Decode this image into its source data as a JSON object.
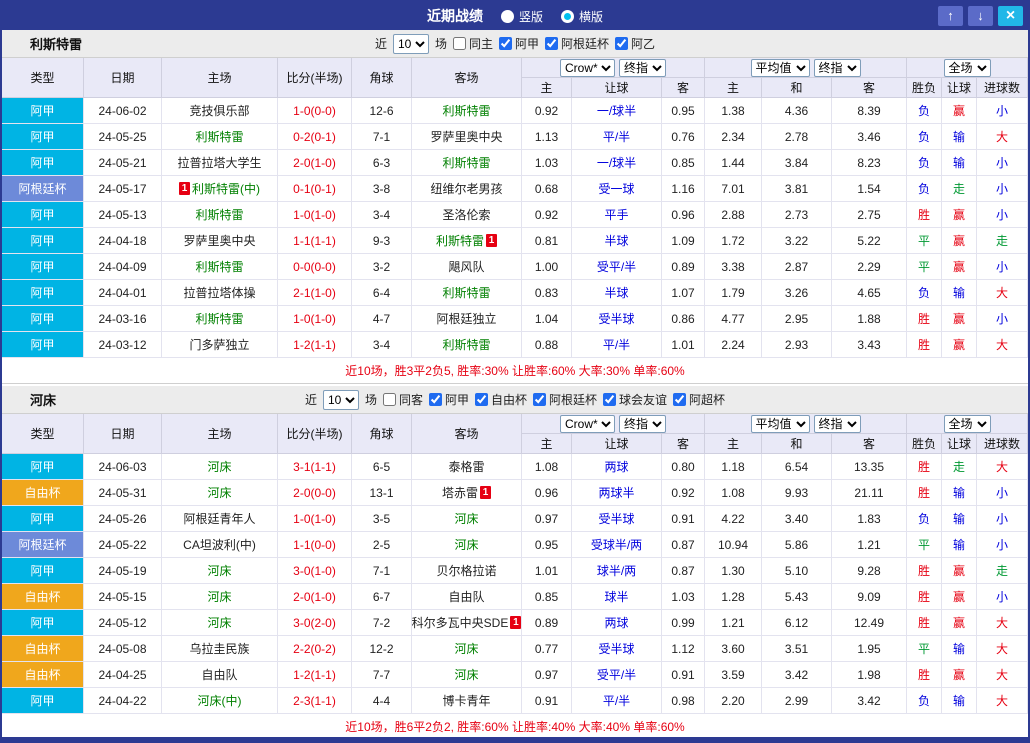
{
  "titlebar": {
    "title": "近期战绩",
    "radio_vertical": "竖版",
    "radio_horizontal": "横版",
    "up_glyph": "↑",
    "down_glyph": "↓",
    "close_glyph": "×"
  },
  "colors": {
    "league": {
      "阿甲": "#00b4e4",
      "阿根廷杯": "#6d8ad9",
      "自由杯": "#f0a71c",
      "阿乙": "#00b4e4"
    },
    "result": {
      "red": "#e60012",
      "blue": "#0000dd",
      "green": "#009933"
    },
    "score": "#e60012",
    "focus_team": "#008000",
    "handicap": "#0000dd",
    "red_card_badge": "#e60012"
  },
  "sections": [
    {
      "team": "利斯特雷",
      "filters": {
        "near_label": "近",
        "count": "10",
        "games_label": "场",
        "same": {
          "label": "同主",
          "checked": false
        },
        "leagues": [
          {
            "label": "阿甲",
            "checked": true
          },
          {
            "label": "阿根廷杯",
            "checked": true
          },
          {
            "label": "阿乙",
            "checked": true
          }
        ]
      },
      "table_header": {
        "static": [
          "类型",
          "日期",
          "主场",
          "比分(半场)",
          "角球",
          "客场"
        ],
        "odds_group": {
          "company": "Crow*",
          "time": "终指",
          "sub": [
            "主",
            "让球",
            "客"
          ]
        },
        "avg_group": {
          "company": "平均值",
          "time": "终指",
          "sub": [
            "主",
            "和",
            "客"
          ]
        },
        "result_group": {
          "scope": "全场",
          "sub": [
            "胜负",
            "让球",
            "进球数"
          ]
        }
      },
      "rows": [
        {
          "league": "阿甲",
          "date": "24-06-02",
          "home": {
            "name": "竞技俱乐部",
            "focus": false
          },
          "score": "1-0(0-0)",
          "corner": "12-6",
          "away": {
            "name": "利斯特雷",
            "focus": true
          },
          "odds": [
            "0.92",
            "一/球半",
            "0.95"
          ],
          "avg": [
            "1.38",
            "4.36",
            "8.39"
          ],
          "results": [
            {
              "text": "负",
              "color": "blue"
            },
            {
              "text": "赢",
              "color": "red"
            },
            {
              "text": "小",
              "color": "blue"
            }
          ]
        },
        {
          "league": "阿甲",
          "date": "24-05-25",
          "home": {
            "name": "利斯特雷",
            "focus": true
          },
          "score": "0-2(0-1)",
          "corner": "7-1",
          "away": {
            "name": "罗萨里奥中央",
            "focus": false
          },
          "odds": [
            "1.13",
            "平/半",
            "0.76"
          ],
          "avg": [
            "2.34",
            "2.78",
            "3.46"
          ],
          "results": [
            {
              "text": "负",
              "color": "blue"
            },
            {
              "text": "输",
              "color": "blue"
            },
            {
              "text": "大",
              "color": "red"
            }
          ]
        },
        {
          "league": "阿甲",
          "date": "24-05-21",
          "home": {
            "name": "拉普拉塔大学生",
            "focus": false
          },
          "score": "2-0(1-0)",
          "corner": "6-3",
          "away": {
            "name": "利斯特雷",
            "focus": true
          },
          "odds": [
            "1.03",
            "一/球半",
            "0.85"
          ],
          "avg": [
            "1.44",
            "3.84",
            "8.23"
          ],
          "results": [
            {
              "text": "负",
              "color": "blue"
            },
            {
              "text": "输",
              "color": "blue"
            },
            {
              "text": "小",
              "color": "blue"
            }
          ]
        },
        {
          "league": "阿根廷杯",
          "date": "24-05-17",
          "home": {
            "name": "利斯特雷(中)",
            "focus": true,
            "red_card": {
              "position": "before",
              "count": "1"
            }
          },
          "score": "0-1(0-1)",
          "corner": "3-8",
          "away": {
            "name": "纽维尔老男孩",
            "focus": false
          },
          "odds": [
            "0.68",
            "受一球",
            "1.16"
          ],
          "avg": [
            "7.01",
            "3.81",
            "1.54"
          ],
          "results": [
            {
              "text": "负",
              "color": "blue"
            },
            {
              "text": "走",
              "color": "green"
            },
            {
              "text": "小",
              "color": "blue"
            }
          ]
        },
        {
          "league": "阿甲",
          "date": "24-05-13",
          "home": {
            "name": "利斯特雷",
            "focus": true
          },
          "score": "1-0(1-0)",
          "corner": "3-4",
          "away": {
            "name": "圣洛伦索",
            "focus": false
          },
          "odds": [
            "0.92",
            "平手",
            "0.96"
          ],
          "avg": [
            "2.88",
            "2.73",
            "2.75"
          ],
          "results": [
            {
              "text": "胜",
              "color": "red"
            },
            {
              "text": "赢",
              "color": "red"
            },
            {
              "text": "小",
              "color": "blue"
            }
          ]
        },
        {
          "league": "阿甲",
          "date": "24-04-18",
          "home": {
            "name": "罗萨里奥中央",
            "focus": false
          },
          "score": "1-1(1-1)",
          "corner": "9-3",
          "away": {
            "name": "利斯特雷",
            "focus": true,
            "red_card": {
              "position": "after",
              "count": "1"
            }
          },
          "odds": [
            "0.81",
            "半球",
            "1.09"
          ],
          "avg": [
            "1.72",
            "3.22",
            "5.22"
          ],
          "results": [
            {
              "text": "平",
              "color": "green"
            },
            {
              "text": "赢",
              "color": "red"
            },
            {
              "text": "走",
              "color": "green"
            }
          ]
        },
        {
          "league": "阿甲",
          "date": "24-04-09",
          "home": {
            "name": "利斯特雷",
            "focus": true
          },
          "score": "0-0(0-0)",
          "corner": "3-2",
          "away": {
            "name": "飓风队",
            "focus": false
          },
          "odds": [
            "1.00",
            "受平/半",
            "0.89"
          ],
          "avg": [
            "3.38",
            "2.87",
            "2.29"
          ],
          "results": [
            {
              "text": "平",
              "color": "green"
            },
            {
              "text": "赢",
              "color": "red"
            },
            {
              "text": "小",
              "color": "blue"
            }
          ]
        },
        {
          "league": "阿甲",
          "date": "24-04-01",
          "home": {
            "name": "拉普拉塔体操",
            "focus": false
          },
          "score": "2-1(1-0)",
          "corner": "6-4",
          "away": {
            "name": "利斯特雷",
            "focus": true
          },
          "odds": [
            "0.83",
            "半球",
            "1.07"
          ],
          "avg": [
            "1.79",
            "3.26",
            "4.65"
          ],
          "results": [
            {
              "text": "负",
              "color": "blue"
            },
            {
              "text": "输",
              "color": "blue"
            },
            {
              "text": "大",
              "color": "red"
            }
          ]
        },
        {
          "league": "阿甲",
          "date": "24-03-16",
          "home": {
            "name": "利斯特雷",
            "focus": true
          },
          "score": "1-0(1-0)",
          "corner": "4-7",
          "away": {
            "name": "阿根廷独立",
            "focus": false
          },
          "odds": [
            "1.04",
            "受半球",
            "0.86"
          ],
          "avg": [
            "4.77",
            "2.95",
            "1.88"
          ],
          "results": [
            {
              "text": "胜",
              "color": "red"
            },
            {
              "text": "赢",
              "color": "red"
            },
            {
              "text": "小",
              "color": "blue"
            }
          ]
        },
        {
          "league": "阿甲",
          "date": "24-03-12",
          "home": {
            "name": "门多萨独立",
            "focus": false
          },
          "score": "1-2(1-1)",
          "corner": "3-4",
          "away": {
            "name": "利斯特雷",
            "focus": true
          },
          "odds": [
            "0.88",
            "平/半",
            "1.01"
          ],
          "avg": [
            "2.24",
            "2.93",
            "3.43"
          ],
          "results": [
            {
              "text": "胜",
              "color": "red"
            },
            {
              "text": "赢",
              "color": "red"
            },
            {
              "text": "大",
              "color": "red"
            }
          ]
        }
      ],
      "summary": "近10场，胜3平2负5, 胜率:30% 让胜率:60% 大率:30% 单率:60%"
    },
    {
      "team": "河床",
      "filters": {
        "near_label": "近",
        "count": "10",
        "games_label": "场",
        "same": {
          "label": "同客",
          "checked": false
        },
        "leagues": [
          {
            "label": "阿甲",
            "checked": true
          },
          {
            "label": "自由杯",
            "checked": true
          },
          {
            "label": "阿根廷杯",
            "checked": true
          },
          {
            "label": "球会友谊",
            "checked": true
          },
          {
            "label": "阿超杯",
            "checked": true
          }
        ]
      },
      "table_header": {
        "static": [
          "类型",
          "日期",
          "主场",
          "比分(半场)",
          "角球",
          "客场"
        ],
        "odds_group": {
          "company": "Crow*",
          "time": "终指",
          "sub": [
            "主",
            "让球",
            "客"
          ]
        },
        "avg_group": {
          "company": "平均值",
          "time": "终指",
          "sub": [
            "主",
            "和",
            "客"
          ]
        },
        "result_group": {
          "scope": "全场",
          "sub": [
            "胜负",
            "让球",
            "进球数"
          ]
        }
      },
      "rows": [
        {
          "league": "阿甲",
          "date": "24-06-03",
          "home": {
            "name": "河床",
            "focus": true
          },
          "score": "3-1(1-1)",
          "corner": "6-5",
          "away": {
            "name": "泰格雷",
            "focus": false
          },
          "odds": [
            "1.08",
            "两球",
            "0.80"
          ],
          "avg": [
            "1.18",
            "6.54",
            "13.35"
          ],
          "results": [
            {
              "text": "胜",
              "color": "red"
            },
            {
              "text": "走",
              "color": "green"
            },
            {
              "text": "大",
              "color": "red"
            }
          ]
        },
        {
          "league": "自由杯",
          "date": "24-05-31",
          "home": {
            "name": "河床",
            "focus": true
          },
          "score": "2-0(0-0)",
          "corner": "13-1",
          "away": {
            "name": "塔赤雷",
            "focus": false,
            "red_card": {
              "position": "after",
              "count": "1"
            }
          },
          "odds": [
            "0.96",
            "两球半",
            "0.92"
          ],
          "avg": [
            "1.08",
            "9.93",
            "21.11"
          ],
          "results": [
            {
              "text": "胜",
              "color": "red"
            },
            {
              "text": "输",
              "color": "blue"
            },
            {
              "text": "小",
              "color": "blue"
            }
          ]
        },
        {
          "league": "阿甲",
          "date": "24-05-26",
          "home": {
            "name": "阿根廷青年人",
            "focus": false
          },
          "score": "1-0(1-0)",
          "corner": "3-5",
          "away": {
            "name": "河床",
            "focus": true
          },
          "odds": [
            "0.97",
            "受半球",
            "0.91"
          ],
          "avg": [
            "4.22",
            "3.40",
            "1.83"
          ],
          "results": [
            {
              "text": "负",
              "color": "blue"
            },
            {
              "text": "输",
              "color": "blue"
            },
            {
              "text": "小",
              "color": "blue"
            }
          ]
        },
        {
          "league": "阿根廷杯",
          "date": "24-05-22",
          "home": {
            "name": "CA坦波利(中)",
            "focus": false
          },
          "score": "1-1(0-0)",
          "corner": "2-5",
          "away": {
            "name": "河床",
            "focus": true
          },
          "odds": [
            "0.95",
            "受球半/两",
            "0.87"
          ],
          "avg": [
            "10.94",
            "5.86",
            "1.21"
          ],
          "results": [
            {
              "text": "平",
              "color": "green"
            },
            {
              "text": "输",
              "color": "blue"
            },
            {
              "text": "小",
              "color": "blue"
            }
          ]
        },
        {
          "league": "阿甲",
          "date": "24-05-19",
          "home": {
            "name": "河床",
            "focus": true
          },
          "score": "3-0(1-0)",
          "corner": "7-1",
          "away": {
            "name": "贝尔格拉诺",
            "focus": false
          },
          "odds": [
            "1.01",
            "球半/两",
            "0.87"
          ],
          "avg": [
            "1.30",
            "5.10",
            "9.28"
          ],
          "results": [
            {
              "text": "胜",
              "color": "red"
            },
            {
              "text": "赢",
              "color": "red"
            },
            {
              "text": "走",
              "color": "green"
            }
          ]
        },
        {
          "league": "自由杯",
          "date": "24-05-15",
          "home": {
            "name": "河床",
            "focus": true
          },
          "score": "2-0(1-0)",
          "corner": "6-7",
          "away": {
            "name": "自由队",
            "focus": false
          },
          "odds": [
            "0.85",
            "球半",
            "1.03"
          ],
          "avg": [
            "1.28",
            "5.43",
            "9.09"
          ],
          "results": [
            {
              "text": "胜",
              "color": "red"
            },
            {
              "text": "赢",
              "color": "red"
            },
            {
              "text": "小",
              "color": "blue"
            }
          ]
        },
        {
          "league": "阿甲",
          "date": "24-05-12",
          "home": {
            "name": "河床",
            "focus": true
          },
          "score": "3-0(2-0)",
          "corner": "7-2",
          "away": {
            "name": "科尔多瓦中央SDE",
            "focus": false,
            "red_card": {
              "position": "after",
              "count": "1"
            }
          },
          "odds": [
            "0.89",
            "两球",
            "0.99"
          ],
          "avg": [
            "1.21",
            "6.12",
            "12.49"
          ],
          "results": [
            {
              "text": "胜",
              "color": "red"
            },
            {
              "text": "赢",
              "color": "red"
            },
            {
              "text": "大",
              "color": "red"
            }
          ]
        },
        {
          "league": "自由杯",
          "date": "24-05-08",
          "home": {
            "name": "乌拉圭民族",
            "focus": false
          },
          "score": "2-2(0-2)",
          "corner": "12-2",
          "away": {
            "name": "河床",
            "focus": true
          },
          "odds": [
            "0.77",
            "受半球",
            "1.12"
          ],
          "avg": [
            "3.60",
            "3.51",
            "1.95"
          ],
          "results": [
            {
              "text": "平",
              "color": "green"
            },
            {
              "text": "输",
              "color": "blue"
            },
            {
              "text": "大",
              "color": "red"
            }
          ]
        },
        {
          "league": "自由杯",
          "date": "24-04-25",
          "home": {
            "name": "自由队",
            "focus": false
          },
          "score": "1-2(1-1)",
          "corner": "7-7",
          "away": {
            "name": "河床",
            "focus": true
          },
          "odds": [
            "0.97",
            "受平/半",
            "0.91"
          ],
          "avg": [
            "3.59",
            "3.42",
            "1.98"
          ],
          "results": [
            {
              "text": "胜",
              "color": "red"
            },
            {
              "text": "赢",
              "color": "red"
            },
            {
              "text": "大",
              "color": "red"
            }
          ]
        },
        {
          "league": "阿甲",
          "date": "24-04-22",
          "home": {
            "name": "河床(中)",
            "focus": true
          },
          "score": "2-3(1-1)",
          "corner": "4-4",
          "away": {
            "name": "博卡青年",
            "focus": false
          },
          "odds": [
            "0.91",
            "平/半",
            "0.98"
          ],
          "avg": [
            "2.20",
            "2.99",
            "3.42"
          ],
          "results": [
            {
              "text": "负",
              "color": "blue"
            },
            {
              "text": "输",
              "color": "blue"
            },
            {
              "text": "大",
              "color": "red"
            }
          ]
        }
      ],
      "summary": "近10场，胜6平2负2, 胜率:60% 让胜率:40% 大率:40% 单率:60%"
    }
  ]
}
